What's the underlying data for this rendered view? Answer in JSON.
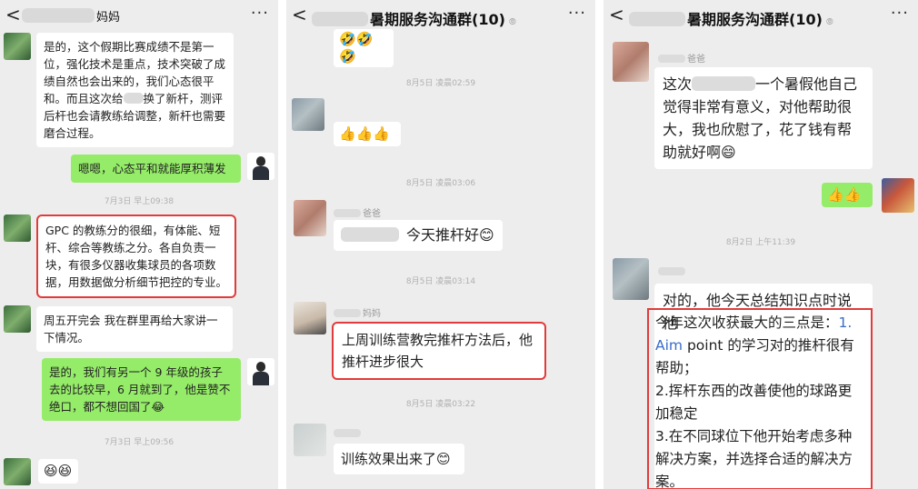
{
  "phone1": {
    "title_suffix": "妈妈",
    "more": "···",
    "back": "<",
    "msgs": [
      "是的，这个假期比赛成绩不是第一位，强化技术是重点，技术突破了成绩自然也会出来的，我们心态很平和。而且这次给",
      "换了新杆，测评后杆也会请教练给调整，新杆也需要磨合过程。",
      "嗯嗯，心态平和就能厚积薄发",
      "GPC 的教练分的很细，有体能、短杆、综合等教练之分。各自负责一块，有很多仪器收集球员的各项数据，用数据做分析细节把控的专业。",
      "周五开完会 我在群里再给大家讲一下情况。",
      "是的，我们有另一个 9 年级的孩子去的比较早，6 月就到了，他是赞不绝口，都不想回国了😂",
      "😆😆"
    ],
    "ts1": "7月3日 早上09:38",
    "ts2": "7月3日 早上09:56"
  },
  "phone2": {
    "title": "暑期服务沟通群(10)",
    "ear": "⦾",
    "more": "···",
    "back": "<",
    "top_emoji": "🤣🤣🤣",
    "ts1": "8月5日 凌晨02:59",
    "thumbs": "👍👍👍",
    "ts2": "8月5日 凌晨03:06",
    "name1": "爸爸",
    "msg1": "今天推杆好😊",
    "ts3": "8月5日 凌晨03:14",
    "name2": "妈妈",
    "msg2": "上周训练营教完推杆方法后，他推杆进步很大",
    "ts4": "8月5日 凌晨03:22",
    "msg3": "训练效果出来了😊"
  },
  "phone3": {
    "title": "暑期服务沟通群(10)",
    "ear": "⦾",
    "more": "···",
    "back": "<",
    "name1": "爸爸",
    "msg1a": "这次",
    "msg1b": "一个暑假他自己觉得非常有意义，对他帮助很大，我也欣慰了，花了钱有帮助就好啊😄",
    "thumbs": "👍👍",
    "ts1": "8月2日 上午11:39",
    "msg2_intro": "对的，他今天总结知识点时说他",
    "msg2_l1": "今年这次收获最大的三点是：",
    "msg2_n1": "1.",
    "msg2_aim": "Aim",
    "msg2_l2": " point 的学习对的推杆很有帮助；",
    "msg2_l3": "2.挥杆东西的改善使他的球路更加稳定",
    "msg2_l4": "3.在不同球位下他开始考虑多种解决方案，并选择合适的解决方案。"
  }
}
